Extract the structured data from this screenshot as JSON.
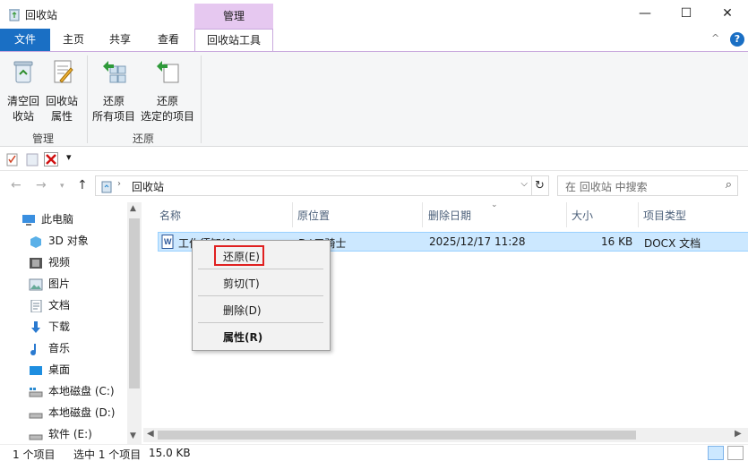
{
  "window": {
    "title": "回收站",
    "contextual_header": "管理",
    "minimize": "—",
    "maximize": "☐",
    "close": "✕"
  },
  "tabs": {
    "file": "文件",
    "home": "主页",
    "share": "共享",
    "view": "查看",
    "tools": "回收站工具",
    "help": "?",
    "collapse": "^"
  },
  "ribbon": {
    "empty_bin": "清空回\n收站",
    "empty_bin_l1": "清空回",
    "empty_bin_l2": "收站",
    "props_l1": "回收站",
    "props_l2": "属性",
    "restore_all_l1": "还原",
    "restore_all_l2": "所有项目",
    "restore_sel_l1": "还原",
    "restore_sel_l2": "选定的项目",
    "group_manage": "管理",
    "group_restore": "还原"
  },
  "qat": {
    "dropdown": "▾"
  },
  "address": {
    "path": "回收站",
    "search_placeholder": "在 回收站 中搜索"
  },
  "nav": {
    "items": [
      {
        "label": "此电脑",
        "icon": "computer-icon"
      },
      {
        "label": "3D 对象",
        "icon": "3d-objects-icon"
      },
      {
        "label": "视频",
        "icon": "video-icon"
      },
      {
        "label": "图片",
        "icon": "pictures-icon"
      },
      {
        "label": "文档",
        "icon": "documents-icon"
      },
      {
        "label": "下载",
        "icon": "download-icon"
      },
      {
        "label": "音乐",
        "icon": "music-icon"
      },
      {
        "label": "桌面",
        "icon": "desktop-icon"
      },
      {
        "label": "本地磁盘 (C:)",
        "icon": "drive-icon"
      },
      {
        "label": "本地磁盘 (D:)",
        "icon": "drive-icon"
      },
      {
        "label": "软件 (E:)",
        "icon": "drive-icon"
      }
    ]
  },
  "columns": {
    "name": "名称",
    "original_location": "原位置",
    "date_deleted": "删除日期",
    "size": "大小",
    "type": "项目类型"
  },
  "files": [
    {
      "name": "工作须知(1)",
      "original_location": "D:\\三骑士",
      "date_deleted": "2025/12/17 11:28",
      "size": "16 KB",
      "type": "DOCX 文档"
    }
  ],
  "context_menu": {
    "restore": "还原(E)",
    "cut": "剪切(T)",
    "delete": "删除(D)",
    "properties": "属性(R)"
  },
  "status": {
    "item_count": "1 个项目",
    "selected": "选中 1 个项目",
    "size": "15.0 KB"
  },
  "colors": {
    "accent": "#1a6fc4",
    "contextual": "#e6c8f0",
    "selection": "#cce8ff",
    "highlight_box": "#e02020"
  }
}
